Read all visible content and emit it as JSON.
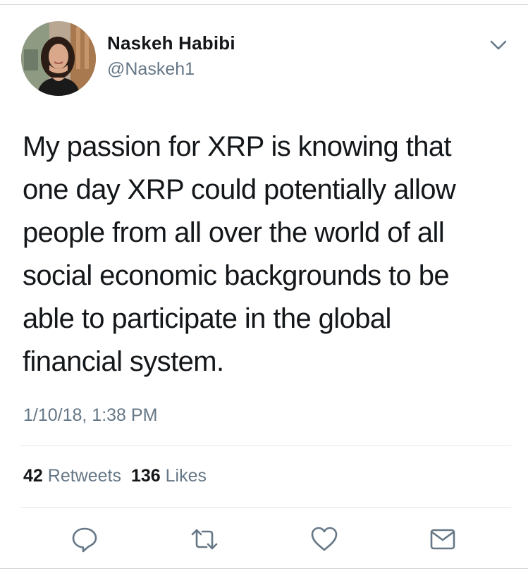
{
  "tweet": {
    "author_name": "Naskeh Habibi",
    "author_handle": "@Naskeh1",
    "text": "My passion for XRP is knowing that\none day XRP could potentially allow\npeople from all over the world of all\nsocial economic backgrounds to be\nable to participate in the global\nfinancial system.",
    "timestamp": "1/10/18, 1:38 PM",
    "retweet_count": "42",
    "retweet_label": "Retweets",
    "like_count": "136",
    "like_label": "Likes"
  },
  "icons": {
    "menu": "chevron-down-icon",
    "reply": "reply-icon",
    "retweet": "retweet-icon",
    "like": "heart-icon",
    "message": "envelope-icon"
  },
  "colors": {
    "text": "#14171a",
    "secondary": "#657786",
    "divider": "#e1e8ed",
    "icon": "#657786"
  }
}
